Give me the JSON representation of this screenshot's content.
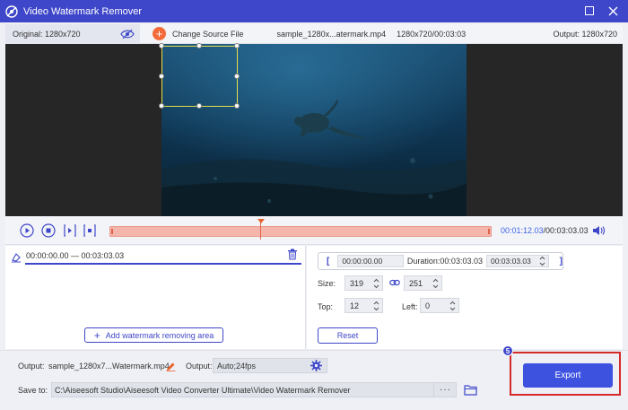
{
  "window": {
    "title": "Video Watermark Remover"
  },
  "infobar": {
    "original_label": "Original: 1280x720",
    "change_source_label": "Change Source File",
    "file_name": "sample_1280x...atermark.mp4",
    "file_resolution": "1280x720/00:03:03",
    "output_label": "Output: 1280x720"
  },
  "playback": {
    "current_time": "00:01:12.03",
    "total_time": "/00:03:03.03",
    "progress": 0.395
  },
  "segment": {
    "range": "00:00:00.00 — 00:03:03.03",
    "add_area_label": "Add watermark removing area"
  },
  "timing": {
    "start": "00:00:00.00",
    "duration_label": "Duration:",
    "duration": "00:03:03.03",
    "end": "00:03:03.03"
  },
  "size": {
    "label": "Size:",
    "width": "319",
    "height": "251"
  },
  "position": {
    "top_label": "Top:",
    "top": "12",
    "left_label": "Left:",
    "left": "0"
  },
  "reset_label": "Reset",
  "output": {
    "label": "Output:",
    "file": "sample_1280x7...Watermark.mp4",
    "format_label": "Output:",
    "format": "Auto;24fps"
  },
  "save": {
    "label": "Save to:",
    "path": "C:\\Aiseesoft Studio\\Aiseesoft Video Converter Ultimate\\Video Watermark Remover",
    "dots": "···"
  },
  "export_label": "Export",
  "step_badge": "5",
  "colors": {
    "accent": "#3e47c9",
    "export": "#3e52e0",
    "highlight": "#d42a2a",
    "timeline": "#f4b6ab",
    "orange": "#f26a3a"
  }
}
